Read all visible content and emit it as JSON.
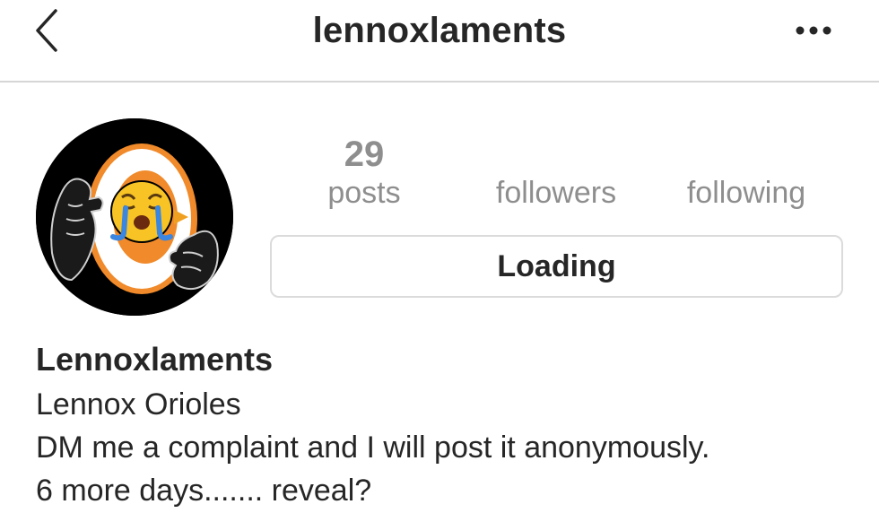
{
  "header": {
    "username": "lennoxlaments",
    "back_icon": "chevron-left-icon",
    "more_icon": "more-horizontal-icon"
  },
  "profile": {
    "avatar_icon": "crying-emoji-avatar",
    "stats": {
      "posts_count": "29",
      "posts_label": "posts",
      "followers_label": "followers",
      "following_label": "following"
    },
    "action_button": "Loading"
  },
  "bio": {
    "name": "Lennoxlaments",
    "lines": [
      "Lennox Orioles",
      "DM me a complaint and I will post it anonymously.",
      "6 more days....... reveal?"
    ]
  },
  "colors": {
    "text": "#262626",
    "muted": "#8e8e8e",
    "border": "#dbdbdb",
    "divider": "#d6d6d6",
    "avatar_bg": "#000000",
    "avatar_ring": "#f08a2a",
    "emoji": "#f7c325",
    "tears": "#3a86e0"
  }
}
